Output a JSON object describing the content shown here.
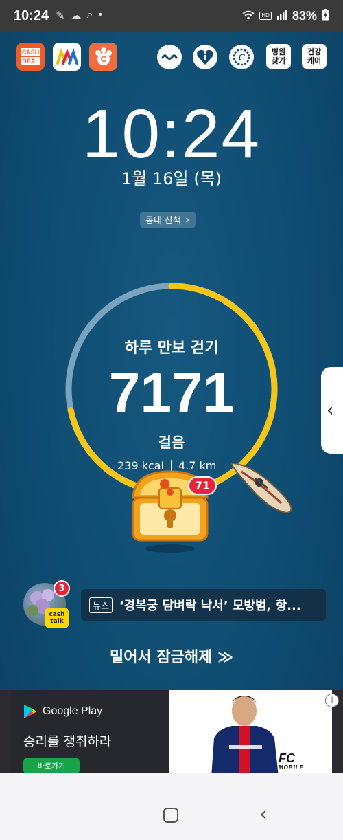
{
  "status_bar": {
    "time": "10:24",
    "battery": "83%",
    "hd_label": "HD",
    "left_icons": [
      "notification-icon",
      "cloud-icon",
      "search-icon",
      "dot-icon"
    ]
  },
  "top_apps": {
    "cashdeal_line1": "CASH",
    "cashdeal_line2": "DEAL",
    "hospital": "병원\n찾기",
    "health": "건강\n케어"
  },
  "lock": {
    "time": "10:24",
    "date": "1월 16일 (목)"
  },
  "walk_chip": {
    "label": "동네 산책",
    "arrow": "›"
  },
  "pedometer": {
    "title": "하루 만보 걷기",
    "steps": "7171",
    "unit": "걸음",
    "kcal": "239 kcal",
    "distance": "4.7 km",
    "progress_fraction": 0.717,
    "progress_color": "#f5c518",
    "track_color": "#7aa3bd"
  },
  "chest": {
    "badge_count": "71"
  },
  "cashtalk": {
    "tag": "cash\ntalk",
    "count": "3"
  },
  "news": {
    "tag": "뉴스",
    "text": "‘경복궁 담벼락 낙서’ 모방범, 항..."
  },
  "unlock": {
    "text": "밀어서 잠금해제 ≫"
  },
  "ad": {
    "store": "Google Play",
    "headline": "승리를 쟁취하라",
    "button": "바로가기",
    "brand_main": "FC",
    "brand_sub": "MOBILE",
    "info": "i",
    "button_color": "#16a34a"
  },
  "side_handle": {
    "arrow": "‹"
  }
}
